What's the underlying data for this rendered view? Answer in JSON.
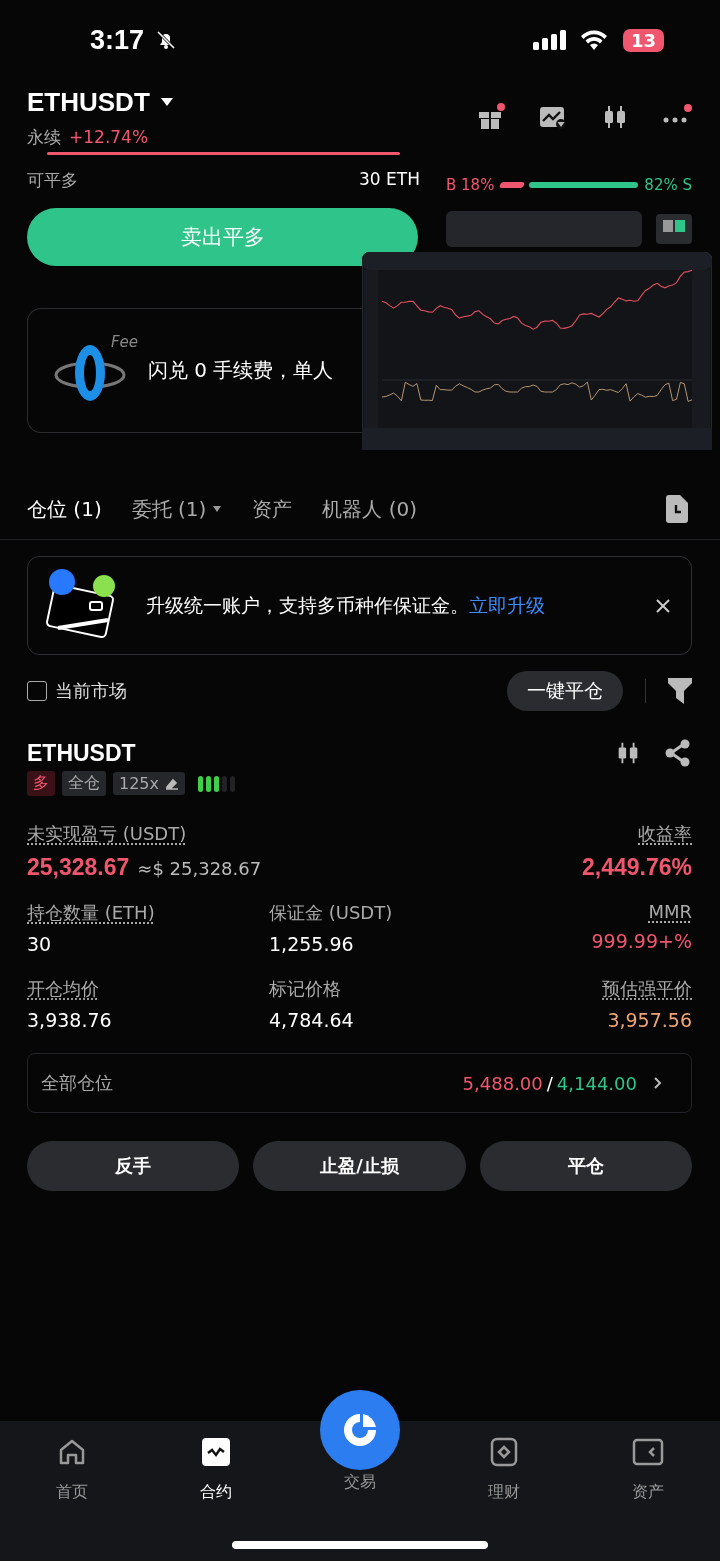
{
  "status_bar": {
    "time": "3:17",
    "battery": "13"
  },
  "header": {
    "symbol": "ETHUSDT",
    "type": "永续",
    "change": "+12.74%"
  },
  "order_panel": {
    "available_label": "可平多",
    "available_value": "30 ETH",
    "sell_button": "卖出平多",
    "buy_ratio": "B 18%",
    "sell_ratio": "82% S",
    "level": 0.18
  },
  "promo": {
    "badge": "Fee",
    "text": "闪兑 0 手续费，单人"
  },
  "tabs": [
    {
      "label": "仓位 (1)",
      "selected": true,
      "dropdown": false
    },
    {
      "label": "委托 (1)",
      "selected": false,
      "dropdown": true
    },
    {
      "label": "资产",
      "selected": false,
      "dropdown": false
    },
    {
      "label": "机器人 (0)",
      "selected": false,
      "dropdown": false
    }
  ],
  "banner": {
    "text": "升级统一账户，支持多币种作保证金。",
    "link": "立即升级"
  },
  "filter": {
    "label": "当前市场",
    "checked": false,
    "close_all": "一键平仓"
  },
  "position": {
    "symbol": "ETHUSDT",
    "side": "多",
    "margin_mode": "全仓",
    "leverage": "125x",
    "pnl_label": "未实现盈亏 (USDT)",
    "pnl": "25,328.67",
    "pnl_usd": "≈$ 25,328.67",
    "roi_label": "收益率",
    "roi": "2,449.76%",
    "stats": [
      {
        "label": "持仓数量 (ETH)",
        "value": "30",
        "dotted": true,
        "color": "#ffffff"
      },
      {
        "label": "保证金 (USDT)",
        "value": "1,255.96",
        "dotted": false,
        "color": "#ffffff"
      },
      {
        "label": "MMR",
        "value": "999.99+%",
        "dotted": true,
        "color": "#f0566e"
      },
      {
        "label": "开仓均价",
        "value": "3,938.76",
        "dotted": true,
        "color": "#ffffff"
      },
      {
        "label": "标记价格",
        "value": "4,784.64",
        "dotted": false,
        "color": "#ffffff"
      },
      {
        "label": "预估强平价",
        "value": "3,957.56",
        "dotted": true,
        "color": "#f0a374"
      }
    ],
    "all_label": "全部仓位",
    "all_long": "5,488.00",
    "all_sep": "/",
    "all_short": "4,144.00",
    "actions": [
      "反手",
      "止盈/止损",
      "平仓"
    ]
  },
  "nav": [
    {
      "label": "首页",
      "selected": false,
      "kind": "home"
    },
    {
      "label": "合约",
      "selected": true,
      "kind": "futures"
    },
    {
      "label": "交易",
      "selected": false,
      "kind": "trade"
    },
    {
      "label": "理财",
      "selected": false,
      "kind": "earn"
    },
    {
      "label": "资产",
      "selected": false,
      "kind": "assets"
    }
  ]
}
